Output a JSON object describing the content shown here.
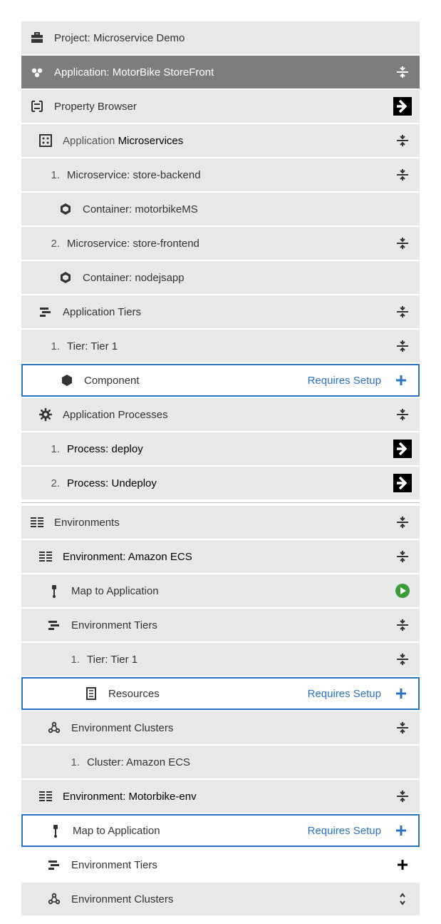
{
  "project": {
    "label": "Project: Microservice Demo"
  },
  "application": {
    "label": "Application: MotorBike StoreFront"
  },
  "propertyBrowser": {
    "label": "Property Browser"
  },
  "appMicroservices": {
    "labelPrefix": "Application ",
    "labelMain": "Microservices",
    "items": [
      {
        "num": "1.",
        "label": "Microservice: store-backend",
        "container": "Container: motorbikeMS"
      },
      {
        "num": "2.",
        "label": "Microservice: store-frontend",
        "container": "Container: nodejsapp"
      }
    ]
  },
  "appTiers": {
    "label": "Application Tiers",
    "items": [
      {
        "num": "1.",
        "label": "Tier: Tier 1",
        "componentLabel": "Component",
        "setup": "Requires Setup"
      }
    ]
  },
  "appProcesses": {
    "label": "Application Processes",
    "items": [
      {
        "num": "1.",
        "label": "Process: deploy"
      },
      {
        "num": "2.",
        "label": "Process: Undeploy"
      }
    ]
  },
  "environments": {
    "label": "Environments",
    "items": [
      {
        "label": "Environment: Amazon ECS",
        "mapLabel": "Map to Application",
        "tiersLabel": "Environment Tiers",
        "tier": {
          "num": "1.",
          "label": "Tier: Tier 1",
          "resourcesLabel": "Resources",
          "setup": "Requires Setup"
        },
        "clustersLabel": "Environment Clusters",
        "cluster": {
          "num": "1.",
          "label": "Cluster: Amazon ECS"
        }
      },
      {
        "label": "Environment: Motorbike-env",
        "mapLabel": "Map to Application",
        "mapSetup": "Requires Setup",
        "tiersLabel": "Environment Tiers",
        "clustersLabel": "Environment Clusters"
      }
    ]
  }
}
